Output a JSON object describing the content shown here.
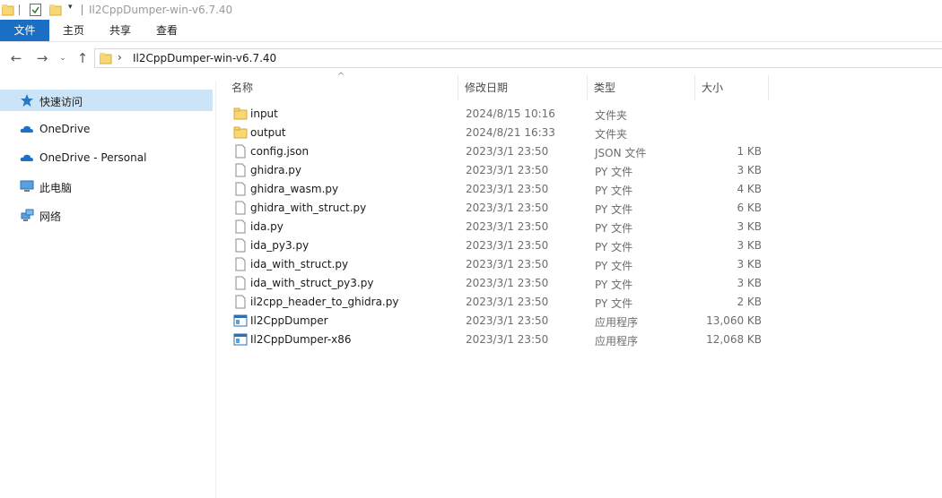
{
  "window": {
    "title": "Il2CppDumper-win-v6.7.40"
  },
  "ribbon": {
    "tabs": [
      "文件",
      "主页",
      "共享",
      "查看"
    ]
  },
  "address": {
    "path": "Il2CppDumper-win-v6.7.40"
  },
  "sidebar": {
    "items": [
      {
        "label": "快速访问",
        "icon": "star-icon",
        "selected": true
      },
      {
        "label": "OneDrive",
        "icon": "cloud-icon"
      },
      {
        "label": "OneDrive - Personal",
        "icon": "cloud-icon"
      },
      {
        "label": "此电脑",
        "icon": "computer-icon"
      },
      {
        "label": "网络",
        "icon": "network-icon"
      }
    ]
  },
  "columns": {
    "name": "名称",
    "date": "修改日期",
    "type": "类型",
    "size": "大小"
  },
  "files": [
    {
      "name": "input",
      "date": "2024/8/15 10:16",
      "type": "文件夹",
      "size": "",
      "icon": "folder-icon"
    },
    {
      "name": "output",
      "date": "2024/8/21 16:33",
      "type": "文件夹",
      "size": "",
      "icon": "folder-icon"
    },
    {
      "name": "config.json",
      "date": "2023/3/1 23:50",
      "type": "JSON 文件",
      "size": "1 KB",
      "icon": "file-icon"
    },
    {
      "name": "ghidra.py",
      "date": "2023/3/1 23:50",
      "type": "PY 文件",
      "size": "3 KB",
      "icon": "file-icon"
    },
    {
      "name": "ghidra_wasm.py",
      "date": "2023/3/1 23:50",
      "type": "PY 文件",
      "size": "4 KB",
      "icon": "file-icon"
    },
    {
      "name": "ghidra_with_struct.py",
      "date": "2023/3/1 23:50",
      "type": "PY 文件",
      "size": "6 KB",
      "icon": "file-icon"
    },
    {
      "name": "ida.py",
      "date": "2023/3/1 23:50",
      "type": "PY 文件",
      "size": "3 KB",
      "icon": "file-icon"
    },
    {
      "name": "ida_py3.py",
      "date": "2023/3/1 23:50",
      "type": "PY 文件",
      "size": "3 KB",
      "icon": "file-icon"
    },
    {
      "name": "ida_with_struct.py",
      "date": "2023/3/1 23:50",
      "type": "PY 文件",
      "size": "3 KB",
      "icon": "file-icon"
    },
    {
      "name": "ida_with_struct_py3.py",
      "date": "2023/3/1 23:50",
      "type": "PY 文件",
      "size": "3 KB",
      "icon": "file-icon"
    },
    {
      "name": "il2cpp_header_to_ghidra.py",
      "date": "2023/3/1 23:50",
      "type": "PY 文件",
      "size": "2 KB",
      "icon": "file-icon"
    },
    {
      "name": "Il2CppDumper",
      "date": "2023/3/1 23:50",
      "type": "应用程序",
      "size": "13,060 KB",
      "icon": "app-icon"
    },
    {
      "name": "Il2CppDumper-x86",
      "date": "2023/3/1 23:50",
      "type": "应用程序",
      "size": "12,068 KB",
      "icon": "app-icon"
    }
  ]
}
